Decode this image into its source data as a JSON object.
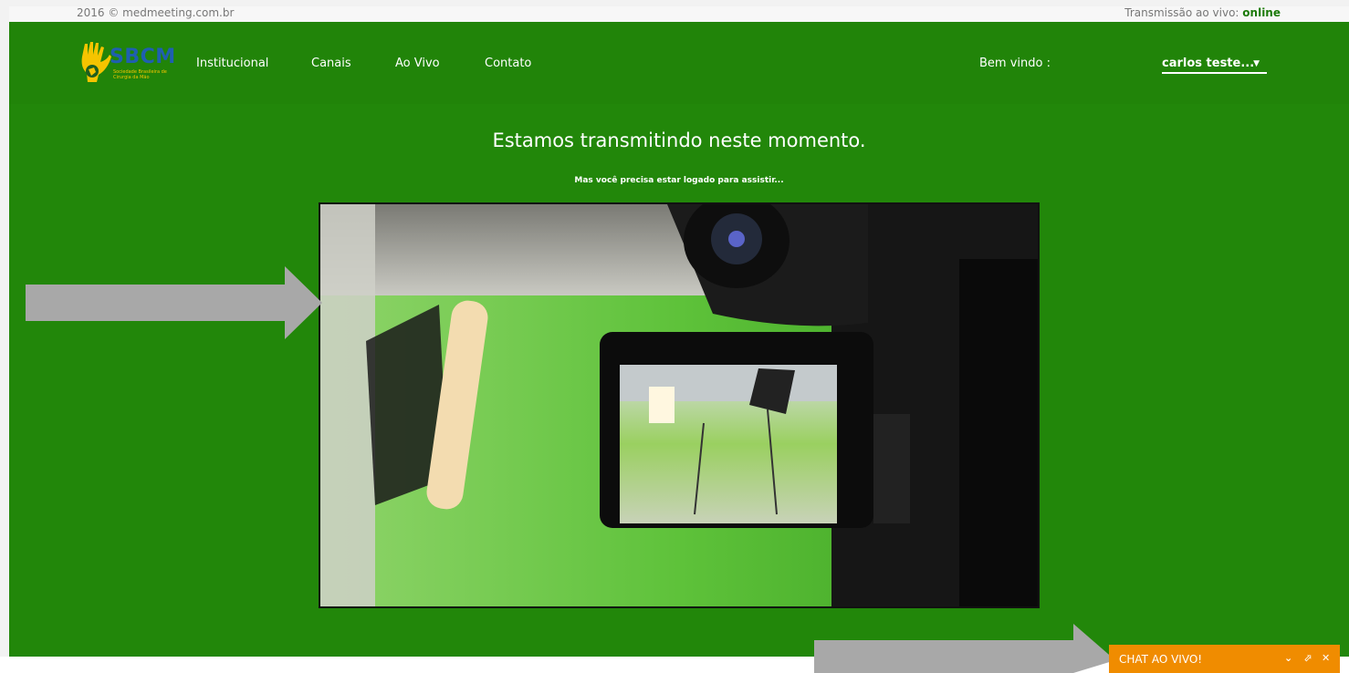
{
  "topbar": {
    "copyright": "2016 © medmeeting.com.br",
    "live_label": "Transmissão ao vivo:",
    "live_status": "online"
  },
  "logo": {
    "name": "SBCM",
    "subtitle": "Sociedade Brasileira de Cirurgia da Mão"
  },
  "nav": {
    "items": [
      {
        "label": "Institucional"
      },
      {
        "label": "Canais"
      },
      {
        "label": "Ao Vivo"
      },
      {
        "label": "Contato"
      }
    ]
  },
  "user": {
    "welcome": "Bem vindo :",
    "name": "carlos teste...",
    "caret": "▼"
  },
  "main": {
    "headline": "Estamos transmitindo neste momento.",
    "subline": "Mas você precisa estar logado para assistir..."
  },
  "chat": {
    "title": "CHAT AO VIVO!",
    "minimize": "⌄",
    "popout": "⬀",
    "close": "✕"
  },
  "colors": {
    "background_green": "#22870a",
    "chat_orange": "#f08c00",
    "arrow_gray": "#a8a8a8"
  }
}
